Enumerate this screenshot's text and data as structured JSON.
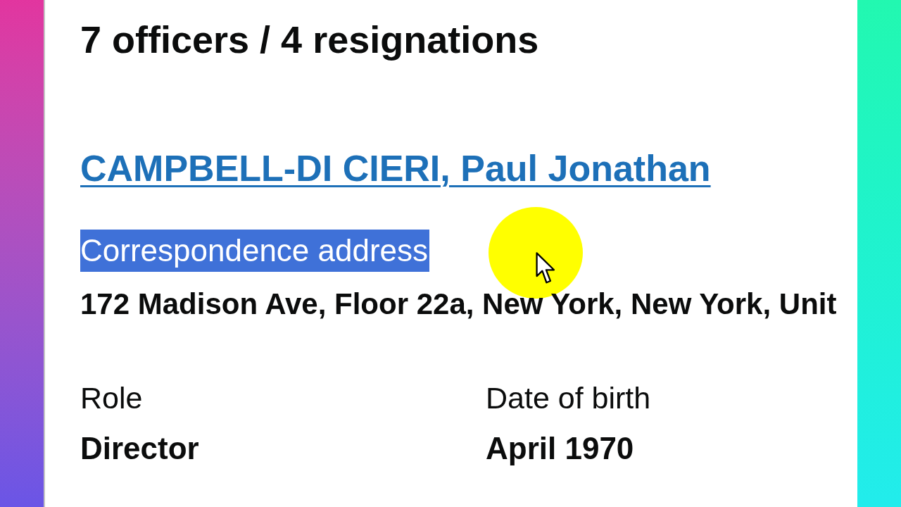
{
  "heading": "7 officers / 4 resignations",
  "officer": {
    "name": "CAMPBELL-DI CIERI, Paul Jonathan",
    "address_label": {
      "text": "Correspondence address",
      "selected": true
    },
    "address": "172 Madison Ave, Floor 22a, New York, New York, Unit",
    "details": [
      {
        "label": "Role",
        "value": "Director"
      },
      {
        "label": "Date of birth",
        "value": "April 1970"
      }
    ]
  }
}
